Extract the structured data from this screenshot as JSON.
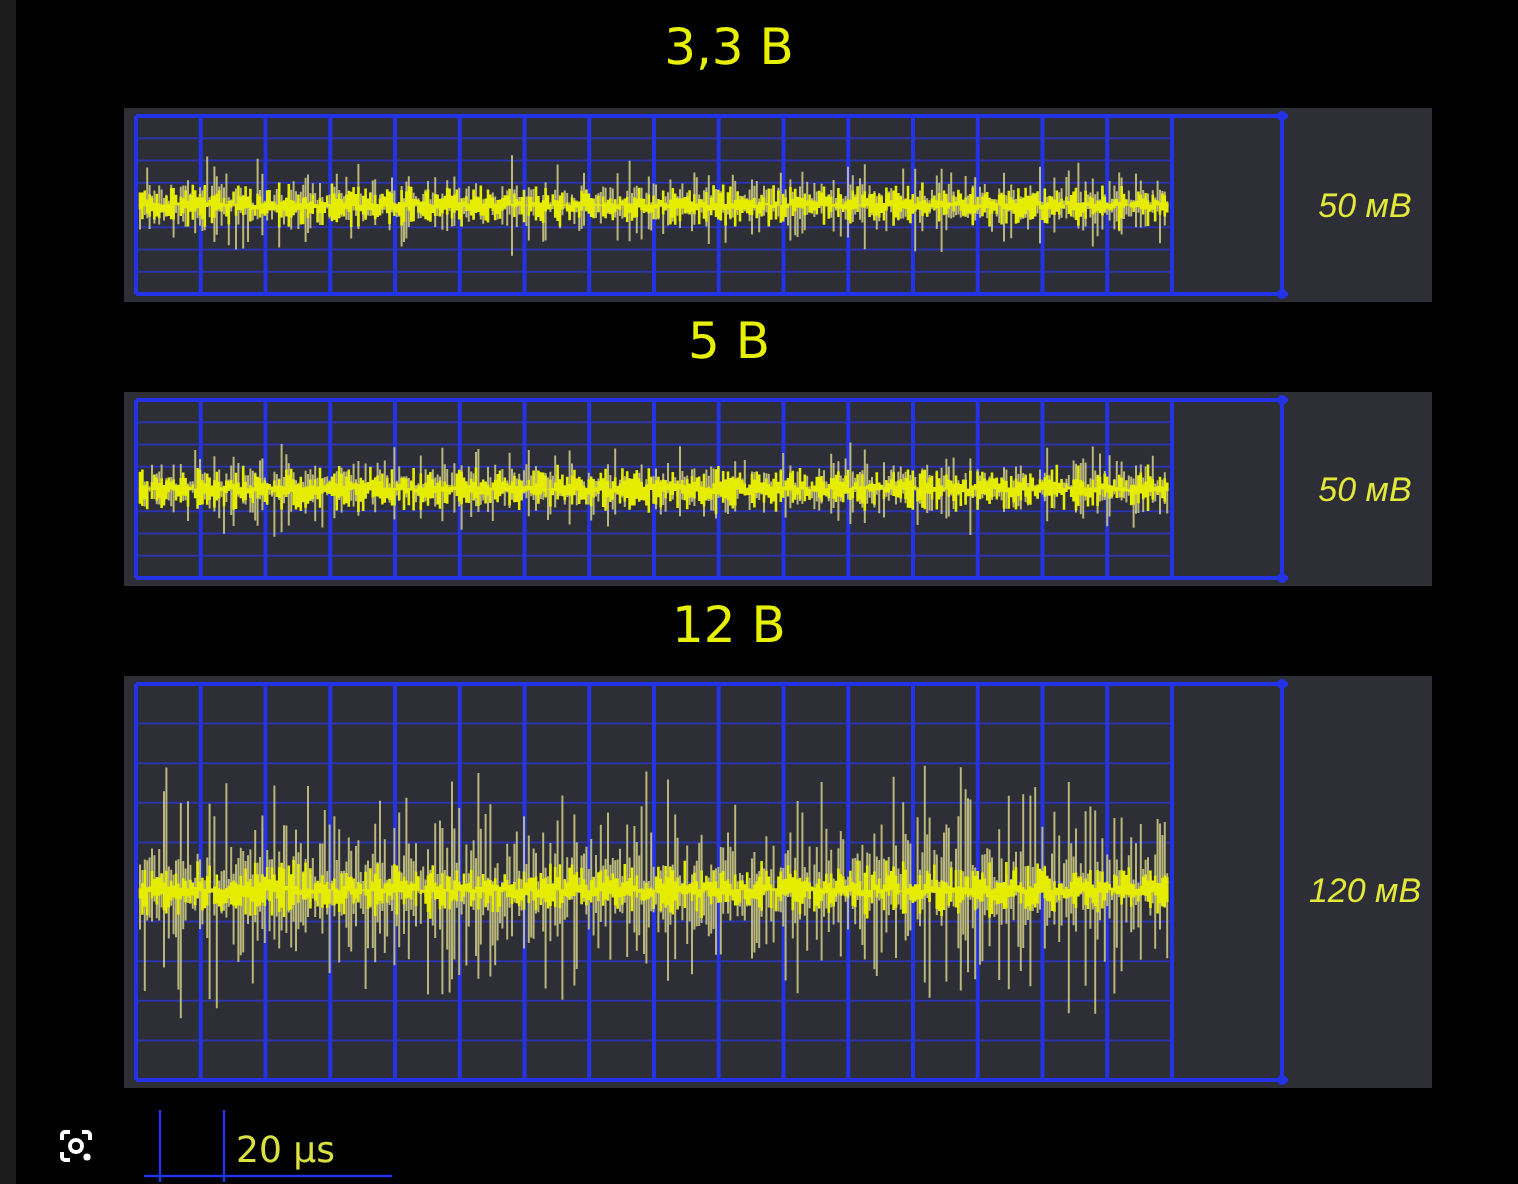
{
  "panels": [
    {
      "title": "3,3 В",
      "kind": "short",
      "reading": "50 мВ"
    },
    {
      "title": "5 В",
      "kind": "short",
      "reading": "50 мВ"
    },
    {
      "title": "12 В",
      "kind": "tall",
      "reading": "120 мВ"
    }
  ],
  "time_scale": {
    "label": "20 µs"
  }
}
